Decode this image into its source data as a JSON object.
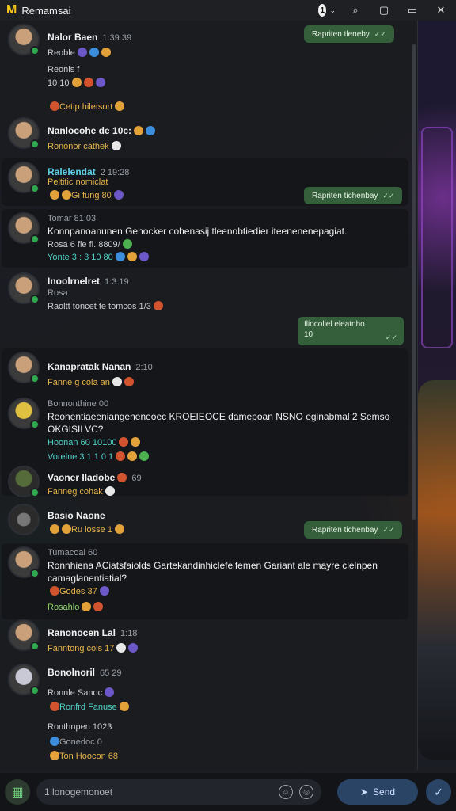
{
  "app": {
    "title": "Remamsai",
    "notif_count": "1"
  },
  "titlebar": {
    "search": "⌕",
    "window": "▢",
    "close": "✕",
    "chevron": "⌄",
    "min": "▭"
  },
  "messages": [
    {
      "name": "Nalor Baen",
      "time": "1:39:39",
      "sub1": "Reoble",
      "sub2": "Reonis f",
      "sub3": "10 10",
      "sub4": "Cetip hiletsort"
    },
    {
      "name": "Nanlocohe de 10c:",
      "sub1": "Rononor cathek"
    },
    {
      "name": "Ralelendat",
      "time": "2 19:28",
      "sub1": "Peltitic nomiclat",
      "sub2": "Gi fung 80"
    },
    {
      "name": "Tomar 81:03",
      "body": "Konnpanoanunen Genocker cohenasij tleenobtiedier iteenenenepagiat.",
      "sub1": "Rosa 6 fle fl. 8809/",
      "sub2": "Yonte 3 : 3 10 80"
    },
    {
      "name": "Inoolrnelret",
      "time": "1:3:19",
      "sub1": "Rosa",
      "sub2": "Raoltt toncet fe tomcos 1/3"
    },
    {
      "name": "Kanapratak Nanan",
      "time": "2:10",
      "sub1": "Fanne g cola an"
    },
    {
      "name": "Bonnonthine 00",
      "body": "Reonentiaeeniangeneneoec KROEIEOCE damepoan NSNO eginabmal 2 Semso OKGISILVC?",
      "sub1": "Hoonan 60 10100",
      "sub2": "Vorelne 3 1 1 0 1"
    },
    {
      "name": "Vaoner Iladobe",
      "time": "69",
      "sub1": "Fanneg cohak"
    },
    {
      "name": "Basio Naone",
      "sub1": "Ru losse 1"
    },
    {
      "name": "Tumacoal 60",
      "body": "Ronnhiena ACiatsfaiolds Gartekandinhiclefelfemen Gariant ale mayre clelnpen camaglanentiatial?",
      "sub1": "Godes 37",
      "sub2": "Rosahlo"
    },
    {
      "name": "Ranonocen Lal",
      "time": "1:18",
      "sub1": "Fanntong cols 17"
    },
    {
      "name": "Bonolnoril",
      "time": "65 29",
      "sub1": "Ronnle Sanoc",
      "sub2": "Ronfrd Fanuse",
      "sub3": "Ronthnpen 1023",
      "sub4": "Gonedoc 0",
      "sub5": "Ton Hoocon 68"
    }
  ],
  "replies": {
    "r1": "Rapriten tleneby",
    "r2": "Rapriten tichenbay",
    "r3": "Rapriten tichenbay",
    "big_line1": "Iliocoliel eleatnho",
    "big_line2": "10"
  },
  "composer": {
    "placeholder": "1 lonogemonoet",
    "send_label": "Send"
  }
}
